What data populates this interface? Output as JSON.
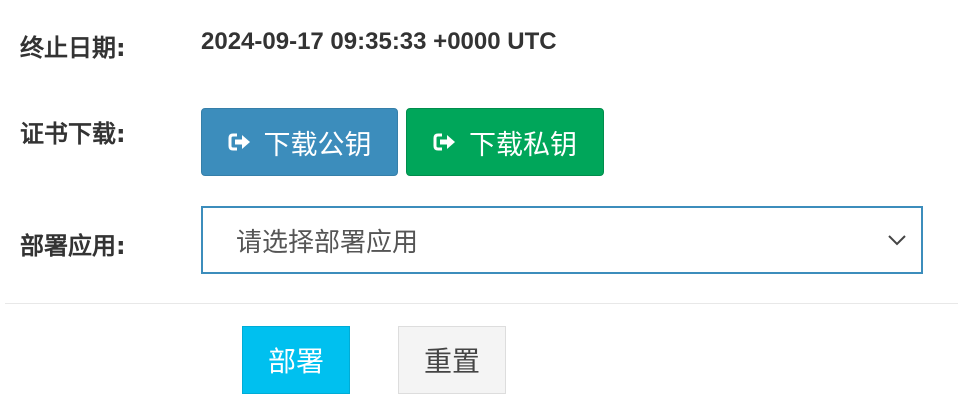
{
  "expire": {
    "label": "终止日期:",
    "value": "2024-09-17 09:35:33 +0000 UTC"
  },
  "download": {
    "label": "证书下载:",
    "public_key_button": "下载公钥",
    "private_key_button": "下载私钥",
    "icon": "sign-out-icon"
  },
  "deploy_app": {
    "label": "部署应用:",
    "placeholder": "请选择部署应用"
  },
  "actions": {
    "deploy_button": "部署",
    "reset_button": "重置"
  },
  "colors": {
    "primary": "#3c8dbc",
    "success": "#00a65a",
    "info": "#00c0ef",
    "default": "#f4f4f4"
  }
}
